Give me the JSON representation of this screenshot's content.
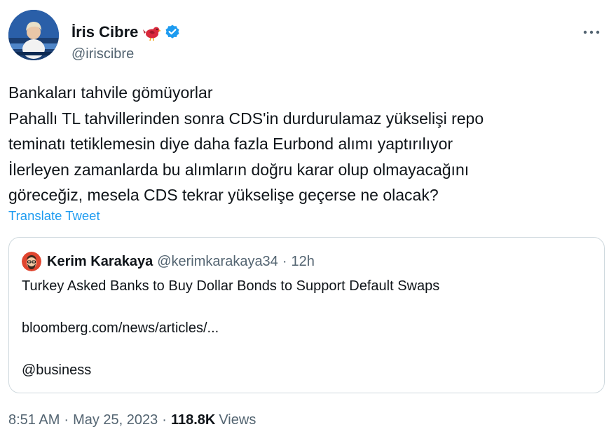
{
  "author": {
    "name": "İris Cibre",
    "handle": "@iriscibre"
  },
  "tweet": {
    "lines": [
      "Bankaları tahvile gömüyorlar",
      "Pahallı TL tahvillerinden sonra CDS'in durdurulamaz yükselişi repo",
      "teminatı tetiklemesin diye daha fazla Eurbond alımı yaptırılıyor",
      "İlerleyen zamanlarda bu alımların doğru karar olup olmayacağını",
      "göreceğiz, mesela CDS tekrar yükselişe geçerse ne olacak?"
    ],
    "translate_label": "Translate Tweet"
  },
  "quote": {
    "name": "Kerim Karakaya",
    "handle": "@kerimkarakaya34",
    "separator": "·",
    "time": "12h",
    "headline": "Turkey Asked Banks to Buy Dollar Bonds to Support Default Swaps",
    "link": "bloomberg.com/news/articles/...",
    "mention": "@business"
  },
  "meta": {
    "time": "8:51 AM",
    "separator": "·",
    "date": "May 25, 2023",
    "views_count": "118.8K",
    "views_label": "Views"
  },
  "colors": {
    "text_primary": "#0f1419",
    "text_secondary": "#536471",
    "link": "#1d9bf0",
    "verified": "#1d9bf0",
    "border": "#cfd9de"
  },
  "icons": {
    "bird": "red-bird-emoji-icon",
    "verified": "verified-badge-icon",
    "more": "more-horizontal-icon"
  }
}
